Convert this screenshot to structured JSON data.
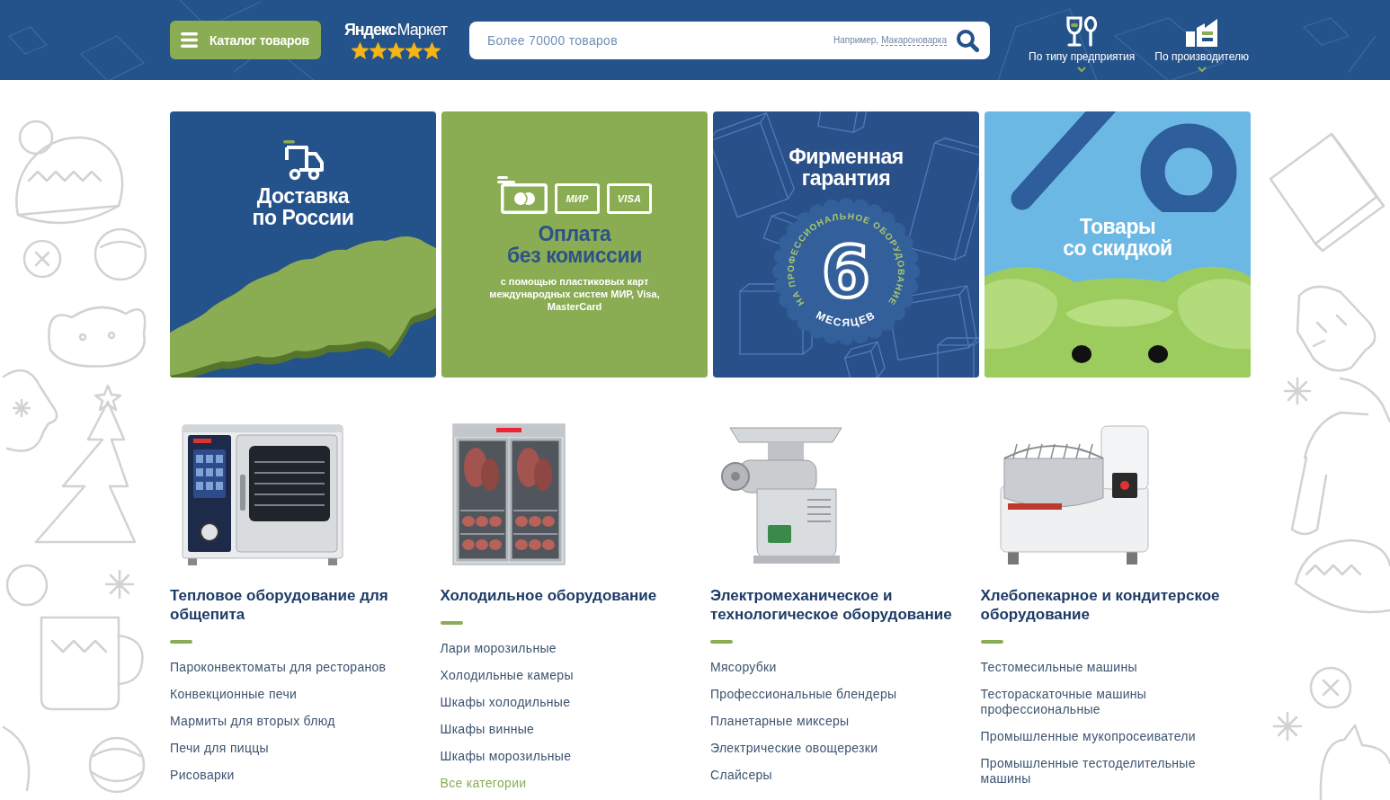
{
  "header": {
    "catalog_button": {
      "label": "Каталог товаров"
    },
    "rating_badge": {
      "brand": "Яндекс",
      "service": "Маркет",
      "stars": 5
    },
    "search": {
      "placeholder": "Более 70000 товаров",
      "hint": "Например,",
      "example": "Макароноварка"
    },
    "nav": [
      {
        "kind": "enterprise",
        "label": "По типу предприятия"
      },
      {
        "kind": "manufacturer",
        "label": "По производителю"
      }
    ]
  },
  "banners": [
    {
      "kind": "delivery",
      "title": "Доставка\nпо России"
    },
    {
      "kind": "payment",
      "title": "Оплата\nбез комиссии",
      "text": "с помощью пластиковых карт\nмеждународных систем МИР, Visa,\nMasterCard",
      "cards": [
        {
          "kind": "bank"
        },
        {
          "kind": "labeled",
          "label": "МИР"
        },
        {
          "kind": "labeled",
          "label": "VISA"
        }
      ]
    },
    {
      "kind": "warranty",
      "title": "Фирменная\nгарантия",
      "seal": {
        "number": "6",
        "arc_text": "НА ПРОФЕССИОНАЛЬНОЕ ОБОРУДОВАНИЕ",
        "unit": "МЕСЯЦЕВ"
      }
    },
    {
      "kind": "discount",
      "title": "Товары\nсо скидкой"
    }
  ],
  "categories": [
    {
      "kind": "oven",
      "title": "Тепловое оборудование для общепита",
      "items": [
        "Пароконвектоматы для ресторанов",
        "Конвекционные печи",
        "Мармиты для вторых блюд",
        "Печи для пиццы",
        "Рисоварки"
      ]
    },
    {
      "kind": "fridge",
      "title": "Холодильное оборудование",
      "items": [
        "Лари морозильные",
        "Холодильные камеры",
        "Шкафы холодильные",
        "Шкафы винные",
        "Шкафы морозильные"
      ],
      "all_link": "Все категории"
    },
    {
      "kind": "grinder",
      "title": "Электромеханическое и технологическое оборудование",
      "items": [
        "Мясорубки",
        "Профессиональные блендеры",
        "Планетарные миксеры",
        "Электрические овощерезки",
        "Слайсеры"
      ]
    },
    {
      "kind": "mixer",
      "title": "Хлебопекарное и кондитерское оборудование",
      "items": [
        "Тестомесильные машины",
        "Тестораскаточные машины профессиональные",
        "Промышленные мукопросеиватели",
        "Промышленные тестоделительные машины"
      ]
    }
  ]
}
